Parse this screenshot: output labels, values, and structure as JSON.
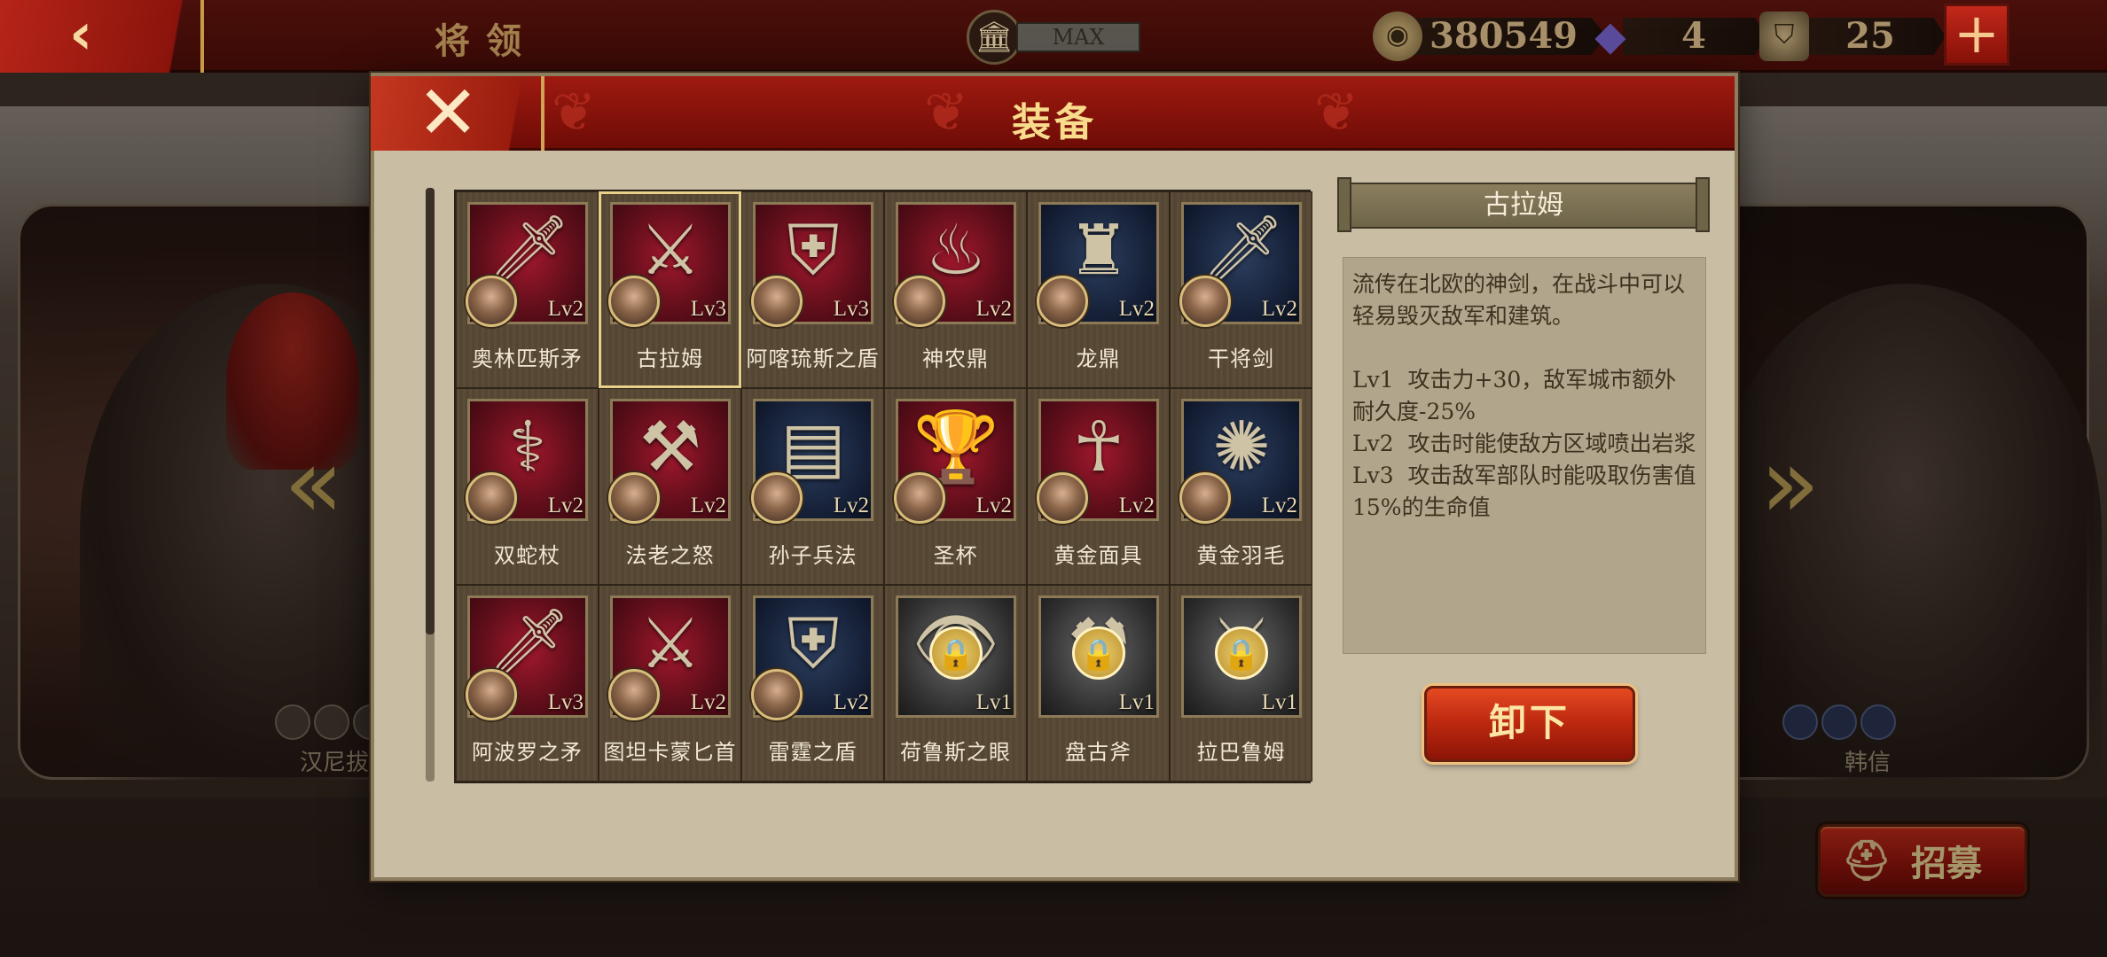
{
  "topbar": {
    "back_icon": "chevron-left-icon",
    "title": "将领",
    "museum_icon": "temple-icon",
    "museum_level": "MAX",
    "coins": "380549",
    "gems": "4",
    "tokens": "25",
    "plus_label": "+"
  },
  "background": {
    "left_hero_name": "汉尼拔",
    "right_hero_name": "韩信",
    "recruit_label": "招募"
  },
  "modal": {
    "title": "装备",
    "close_label": "✕"
  },
  "items": [
    {
      "name": "奥林匹斯矛",
      "level": "Lv2",
      "bg": "red",
      "glyph": "🗡",
      "locked": false,
      "selected": false
    },
    {
      "name": "古拉姆",
      "level": "Lv3",
      "bg": "red",
      "glyph": "⚔",
      "locked": false,
      "selected": true
    },
    {
      "name": "阿喀琉斯之盾",
      "level": "Lv3",
      "bg": "red",
      "glyph": "⛨",
      "locked": false,
      "selected": false
    },
    {
      "name": "神农鼎",
      "level": "Lv2",
      "bg": "red",
      "glyph": "♨",
      "locked": false,
      "selected": false
    },
    {
      "name": "龙鼎",
      "level": "Lv2",
      "bg": "blue",
      "glyph": "♜",
      "locked": false,
      "selected": false
    },
    {
      "name": "干将剑",
      "level": "Lv2",
      "bg": "blue",
      "glyph": "🗡",
      "locked": false,
      "selected": false
    },
    {
      "name": "双蛇杖",
      "level": "Lv2",
      "bg": "red",
      "glyph": "⚕",
      "locked": false,
      "selected": false
    },
    {
      "name": "法老之怒",
      "level": "Lv2",
      "bg": "red",
      "glyph": "⚒",
      "locked": false,
      "selected": false
    },
    {
      "name": "孙子兵法",
      "level": "Lv2",
      "bg": "blue",
      "glyph": "▤",
      "locked": false,
      "selected": false
    },
    {
      "name": "圣杯",
      "level": "Lv2",
      "bg": "red",
      "glyph": "🏆",
      "locked": false,
      "selected": false
    },
    {
      "name": "黄金面具",
      "level": "Lv2",
      "bg": "red",
      "glyph": "☥",
      "locked": false,
      "selected": false
    },
    {
      "name": "黄金羽毛",
      "level": "Lv2",
      "bg": "blue",
      "glyph": "✺",
      "locked": false,
      "selected": false
    },
    {
      "name": "阿波罗之矛",
      "level": "Lv3",
      "bg": "red",
      "glyph": "🗡",
      "locked": false,
      "selected": false
    },
    {
      "name": "图坦卡蒙匕首",
      "level": "Lv2",
      "bg": "red",
      "glyph": "⚔",
      "locked": false,
      "selected": false
    },
    {
      "name": "雷霆之盾",
      "level": "Lv2",
      "bg": "blue",
      "glyph": "⛨",
      "locked": false,
      "selected": false
    },
    {
      "name": "荷鲁斯之眼",
      "level": "Lv1",
      "bg": "grey",
      "glyph": "👁",
      "locked": true,
      "selected": false
    },
    {
      "name": "盘古斧",
      "level": "Lv1",
      "bg": "grey",
      "glyph": "⚒",
      "locked": true,
      "selected": false
    },
    {
      "name": "拉巴鲁姆",
      "level": "Lv1",
      "bg": "grey",
      "glyph": "⚔",
      "locked": true,
      "selected": false
    }
  ],
  "detail": {
    "title": "古拉姆",
    "description": "流传在北欧的神剑，在战斗中可以轻易毁灭敌军和建筑。",
    "effects": "Lv1  攻击力+30，敌军城市额外耐久度-25%\nLv2  攻击时能使敌方区域喷出岩浆\nLv3  攻击敌军部队时能吸取伤害值15%的生命值",
    "unequip_label": "卸下"
  }
}
